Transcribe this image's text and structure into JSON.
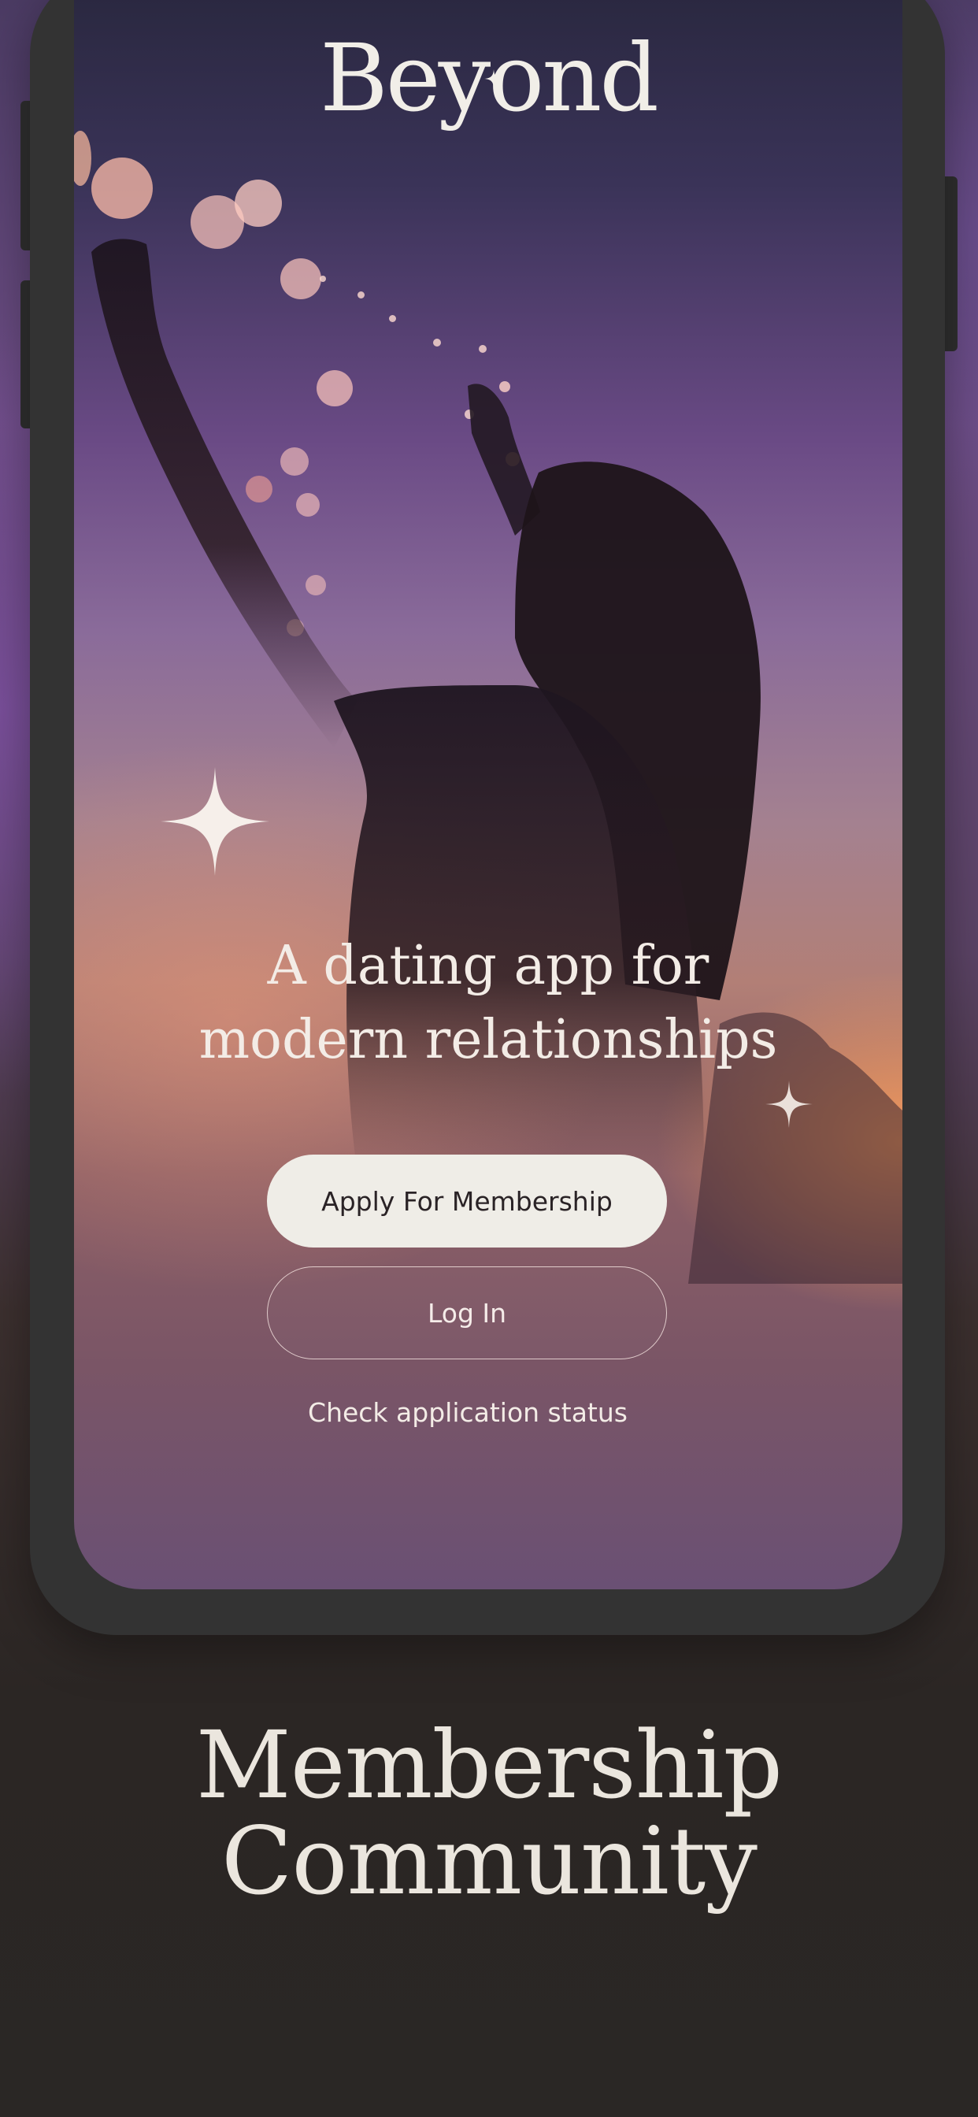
{
  "app": {
    "logo_text": "Beyond",
    "tagline_line1": "A dating app for",
    "tagline_line2": "modern relationships"
  },
  "actions": {
    "apply_label": "Apply For Membership",
    "login_label": "Log In",
    "status_label": "Check application status"
  },
  "promo": {
    "headline_line1": "Membership",
    "headline_line2": "Community"
  },
  "icons": {
    "large_sparkle": "four-point-star-icon",
    "small_sparkle": "four-point-star-icon"
  },
  "colors": {
    "primary_button_bg": "#efede7",
    "primary_button_text": "#2a2326",
    "text_light": "#f3ece6",
    "phone_frame": "#333333"
  }
}
